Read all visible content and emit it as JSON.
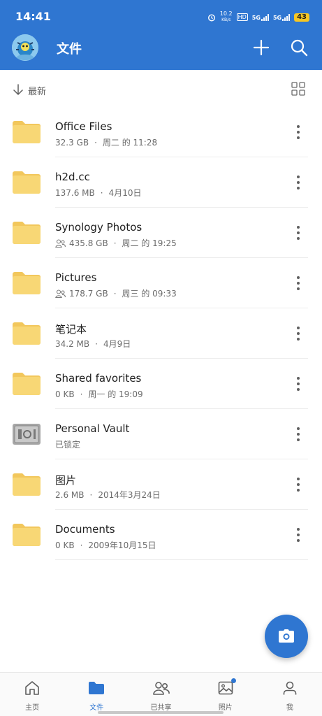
{
  "status_bar": {
    "time": "14:41",
    "net_speed_value": "10.2",
    "net_speed_unit": "KB/s",
    "hd_label": "HD",
    "signal1_label": "5G",
    "signal2_label": "5G",
    "battery": "43"
  },
  "header": {
    "title": "文件",
    "icons": [
      "avatar",
      "add-icon",
      "search-icon"
    ]
  },
  "sort": {
    "label": "最新",
    "icons": [
      "arrow-down-icon",
      "grid-view-icon"
    ]
  },
  "items": [
    {
      "name": "Office Files",
      "size": "32.3 GB",
      "date": "周二 的 11:28",
      "shared": false,
      "icon": "folder-icon"
    },
    {
      "name": "h2d.cc",
      "size": "137.6 MB",
      "date": "4月10日",
      "shared": false,
      "icon": "folder-icon"
    },
    {
      "name": "Synology Photos",
      "size": "435.8 GB",
      "date": "周二 的 19:25",
      "shared": true,
      "icon": "folder-icon"
    },
    {
      "name": "Pictures",
      "size": "178.7 GB",
      "date": "周三 的 09:33",
      "shared": true,
      "icon": "folder-icon"
    },
    {
      "name": "笔记本",
      "size": "34.2 MB",
      "date": "4月9日",
      "shared": false,
      "icon": "folder-icon"
    },
    {
      "name": "Shared favorites",
      "size": "0 KB",
      "date": "周一 的 19:09",
      "shared": false,
      "icon": "folder-icon"
    },
    {
      "name": "Personal Vault",
      "size": "已锁定",
      "date": "",
      "shared": false,
      "icon": "vault-icon"
    },
    {
      "name": "图片",
      "size": "2.6 MB",
      "date": "2014年3月24日",
      "shared": false,
      "icon": "folder-icon"
    },
    {
      "name": "Documents",
      "size": "0 KB",
      "date": "2009年10月15日",
      "shared": false,
      "icon": "folder-icon"
    }
  ],
  "meta_separator": "·",
  "fab": {
    "icon": "camera-icon"
  },
  "bottom_nav": [
    {
      "label": "主页",
      "icon": "home-icon",
      "active": false
    },
    {
      "label": "文件",
      "icon": "folder-icon",
      "active": true
    },
    {
      "label": "已共享",
      "icon": "people-icon",
      "active": false
    },
    {
      "label": "照片",
      "icon": "photo-icon",
      "active": false,
      "badge": true
    },
    {
      "label": "我",
      "icon": "person-icon",
      "active": false
    }
  ],
  "colors": {
    "accent": "#2f76d1",
    "folder": "#f8d775",
    "folder_tab": "#f2c75c",
    "text_primary": "#1f1f1f",
    "text_secondary": "#6b6b6b",
    "battery": "#f6c623"
  }
}
